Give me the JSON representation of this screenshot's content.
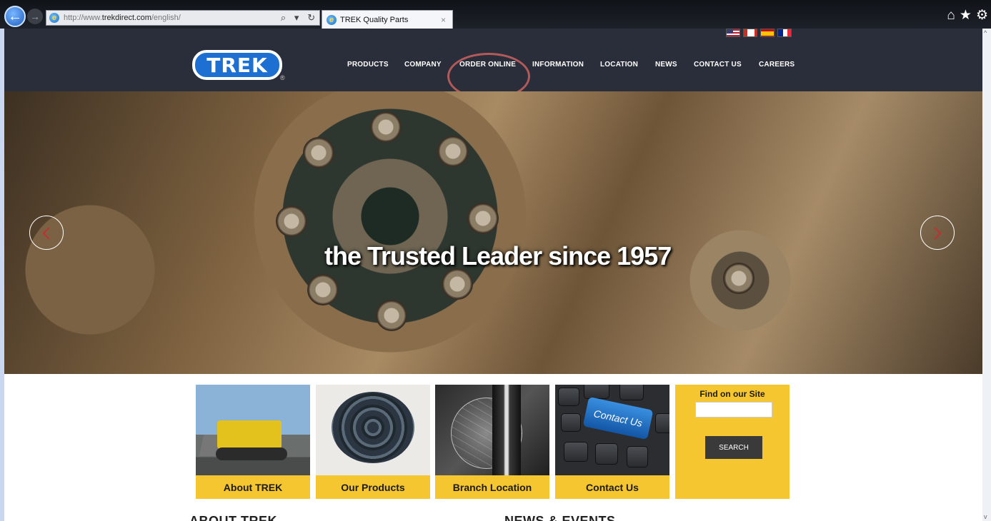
{
  "browser": {
    "back_glyph": "←",
    "forward_glyph": "→",
    "url_prefix": "http://www.",
    "url_domain": "trekdirect.com",
    "url_path": "/english/",
    "ie_glyph": "e",
    "address_tools": [
      "⌕",
      "▾",
      "↻"
    ],
    "tab_title": "TREK Quality Parts",
    "tab_close": "×",
    "icons": [
      "home-icon",
      "star-icon",
      "gear-icon"
    ],
    "icon_glyphs": {
      "home": "⌂",
      "star": "★",
      "gear": "⚙"
    }
  },
  "header": {
    "logo_text": "TREK",
    "logo_registered": "®",
    "flags": [
      "us-flag",
      "canada-flag",
      "spain-flag",
      "france-flag"
    ],
    "nav": [
      {
        "label": "PRODUCTS"
      },
      {
        "label": "COMPANY"
      },
      {
        "label": "ORDER ONLINE"
      },
      {
        "label": "INFORMATION"
      },
      {
        "label": "LOCATION"
      },
      {
        "label": "NEWS"
      },
      {
        "label": "CONTACT US"
      },
      {
        "label": "CAREERS"
      }
    ],
    "annotation_color": "#b25a5a"
  },
  "hero": {
    "tagline": "the Trusted Leader since 1957"
  },
  "tiles": [
    {
      "caption": "About TREK"
    },
    {
      "caption": "Our Products"
    },
    {
      "caption": "Branch Location"
    },
    {
      "caption": "Contact Us"
    }
  ],
  "contact_key_text": "Contact Us",
  "search": {
    "title": "Find on our Site",
    "value": "",
    "button_label": "SEARCH"
  },
  "sections": {
    "about": "ABOUT TREK",
    "news": "NEWS & EVENTS"
  },
  "colors": {
    "header_bg": "#2a2e3a",
    "accent_yellow": "#f6c630",
    "logo_blue": "#1d6fd1"
  }
}
